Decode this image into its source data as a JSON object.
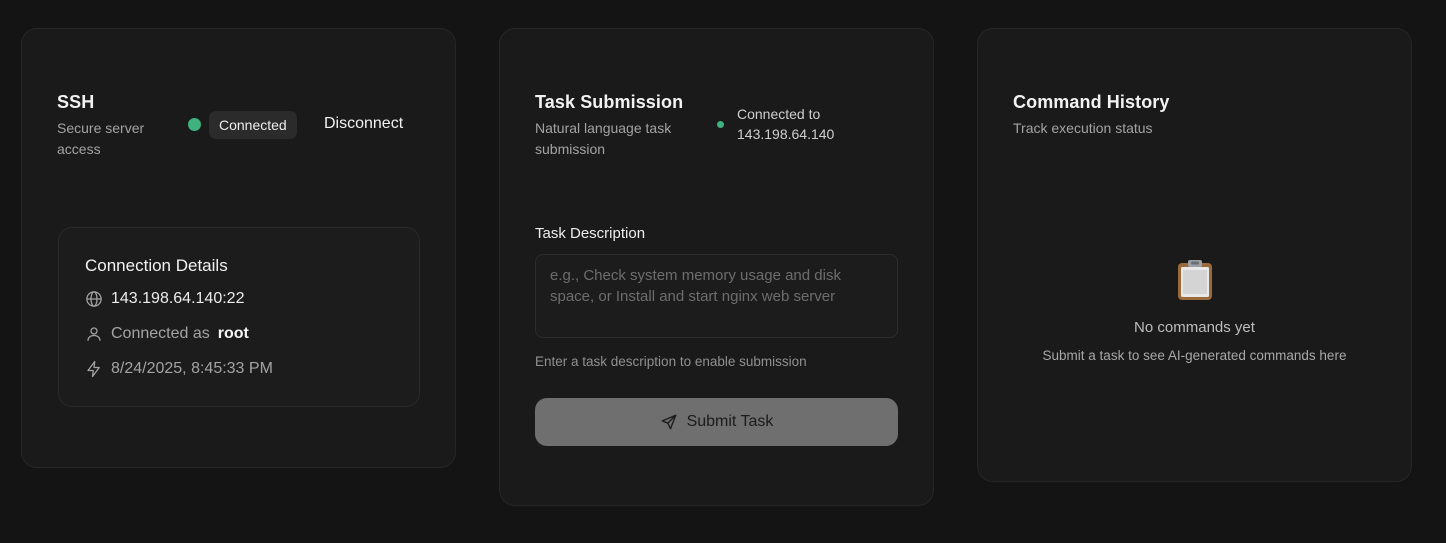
{
  "ssh": {
    "title": "SSH",
    "subtitle": "Secure server access",
    "status": "Connected",
    "disconnect_label": "Disconnect",
    "details": {
      "title": "Connection Details",
      "host": "143.198.64.140:22",
      "user_prefix": "Connected as",
      "user": "root",
      "timestamp": "8/24/2025, 8:45:33 PM"
    }
  },
  "task": {
    "title": "Task Submission",
    "subtitle": "Natural language task submission",
    "connection_label": "Connected to",
    "connection_host": "143.198.64.140",
    "field_label": "Task Description",
    "placeholder": "e.g., Check system memory usage and disk space, or Install and start nginx web server",
    "value": "",
    "hint": "Enter a task description to enable submission",
    "submit_label": "Submit Task"
  },
  "history": {
    "title": "Command History",
    "subtitle": "Track execution status",
    "empty_title": "No commands yet",
    "empty_subtitle": "Submit a task to see AI-generated commands here"
  },
  "colors": {
    "background": "#141414",
    "card": "#1a1a1a",
    "status_green": "#3fb27f",
    "submit_disabled": "#6f6f6f"
  },
  "icons": [
    "globe-icon",
    "user-icon",
    "bolt-icon",
    "send-icon",
    "clipboard-icon"
  ]
}
